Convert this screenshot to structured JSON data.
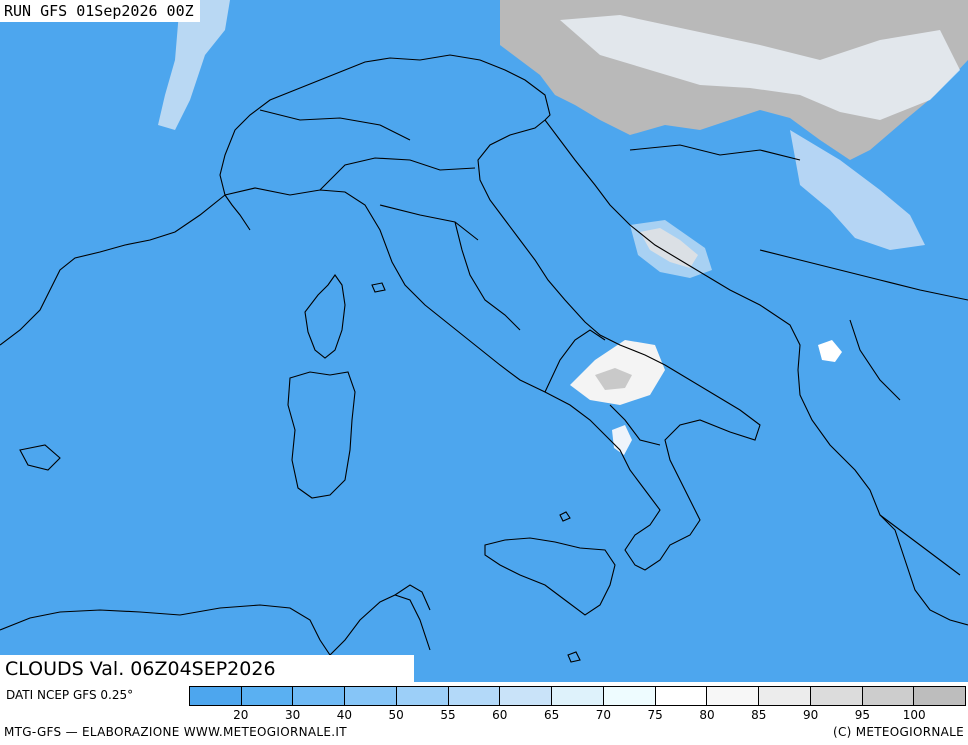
{
  "run_label": "RUN GFS 01Sep2026 00Z",
  "title": "CLOUDS Val. 06Z04SEP2026",
  "data_source": "DATI NCEP GFS 0.25°",
  "footer_left": "MTG-GFS — ELABORAZIONE WWW.METEOGIORNALE.IT",
  "footer_right": "(C) METEOGIORNALE",
  "legend": {
    "unit": "%",
    "colors": [
      "#4da6ee",
      "#5ab0f2",
      "#6fbaf5",
      "#86c5f7",
      "#9ccff8",
      "#b3d9f9",
      "#c9e3f9",
      "#def2fb",
      "#eefcff",
      "#ffffff",
      "#f7f7f7",
      "#ececec",
      "#dcdcdc",
      "#cdcdcd",
      "#bdbdbd"
    ],
    "labels": [
      "20",
      "30",
      "40",
      "50",
      "55",
      "60",
      "65",
      "70",
      "75",
      "80",
      "85",
      "90",
      "95",
      "100"
    ]
  },
  "map": {
    "sea_color": "#4da6ee",
    "coast_color": "#000000"
  }
}
